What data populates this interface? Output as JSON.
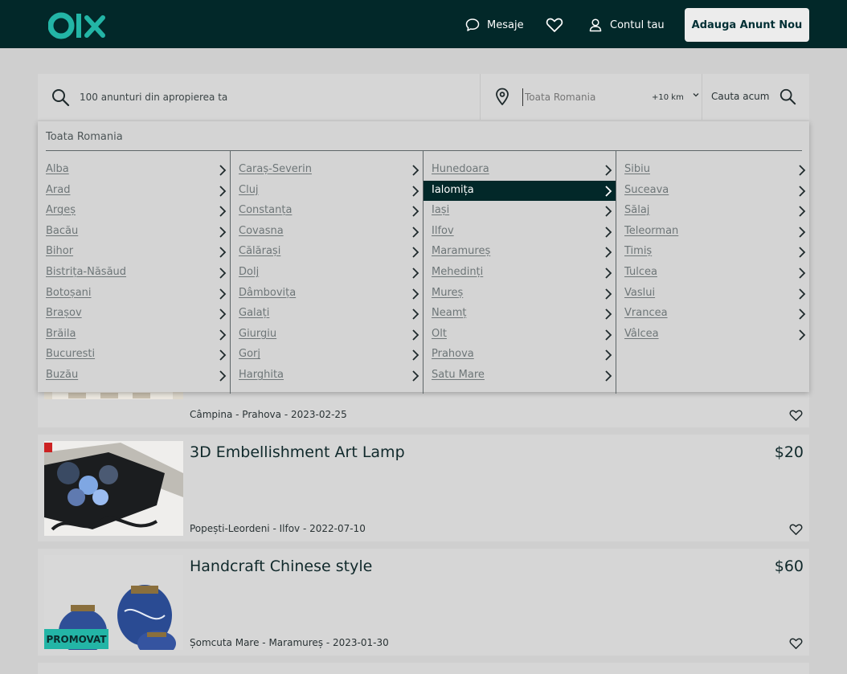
{
  "header": {
    "messages_label": "Mesaje",
    "account_label": "Contul tau",
    "add_button_label": "Adauga Anunt Nou"
  },
  "search": {
    "query_placeholder": "100 anunturi din apropierea ta",
    "location_placeholder": "Toata Romania",
    "radius_value": "+10 km",
    "submit_label": "Cauta acum"
  },
  "location_dropdown": {
    "all_label": "Toata Romania",
    "selected": "Ialomița",
    "columns": [
      [
        "Alba",
        "Arad",
        "Argeș",
        "Bacău",
        "Bihor",
        "Bistrița-Năsăud",
        "Botoșani",
        "Brașov",
        "Brăila",
        "Bucuresti",
        "Buzău"
      ],
      [
        "Caraș-Severin",
        "Cluj",
        "Constanța",
        "Covasna",
        "Călărași",
        "Dolj",
        "Dâmbovița",
        "Galați",
        "Giurgiu",
        "Gorj",
        "Harghita"
      ],
      [
        "Hunedoara",
        "Ialomița",
        "Iași",
        "Ilfov",
        "Maramureș",
        "Mehedinți",
        "Mureș",
        "Neamț",
        "Olt",
        "Prahova",
        "Satu Mare"
      ],
      [
        "Sibiu",
        "Suceava",
        "Sălaj",
        "Teleorman",
        "Timiș",
        "Tulcea",
        "Vaslui",
        "Vrancea",
        "Vâlcea"
      ]
    ]
  },
  "listings": [
    {
      "title": "",
      "price": "",
      "meta": "Câmpina - Prahova - 2023-02-25",
      "promoted": false
    },
    {
      "title": "3D Embellishment Art Lamp",
      "price": "$20",
      "meta": "Popești-Leordeni - Ilfov - 2022-07-10",
      "promoted": false
    },
    {
      "title": "Handcraft Chinese style",
      "price": "$60",
      "meta": "Șomcuta Mare - Maramureș - 2023-01-30",
      "promoted": true,
      "promo_label": "PROMOVAT"
    }
  ],
  "colors": {
    "header_bg": "#022829",
    "accent": "#23b5a6",
    "active_region_bg": "#022829"
  }
}
